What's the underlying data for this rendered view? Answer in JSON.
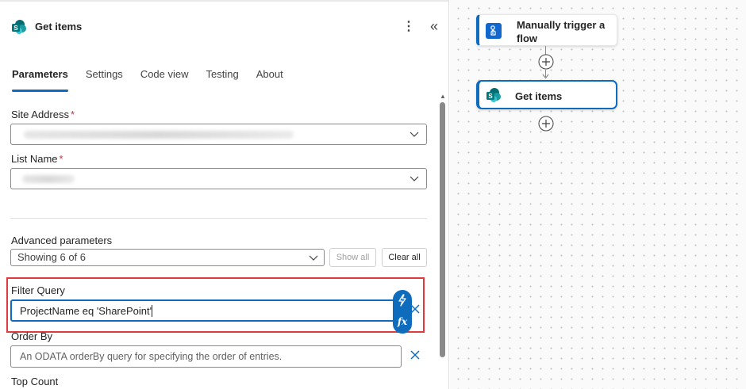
{
  "panel": {
    "title": "Get items",
    "tabs": [
      "Parameters",
      "Settings",
      "Code view",
      "Testing",
      "About"
    ],
    "active_tab": "Parameters",
    "fields": {
      "site_address": {
        "label": "Site Address",
        "required_mark": "*"
      },
      "list_name": {
        "label": "List Name",
        "required_mark": "*"
      },
      "advanced": {
        "label": "Advanced parameters",
        "value": "Showing 6 of 6",
        "show_all": "Show all",
        "clear_all": "Clear all"
      },
      "filter_query": {
        "label": "Filter Query",
        "value": "ProjectName eq 'SharePoint'"
      },
      "order_by": {
        "label": "Order By",
        "placeholder": "An ODATA orderBy query for specifying the order of entries."
      },
      "top_count": {
        "label": "Top Count"
      }
    }
  },
  "canvas": {
    "nodes": [
      {
        "title": "Manually trigger a flow",
        "line1": "Manually trigger a",
        "line2": "flow"
      },
      {
        "title": "Get items"
      }
    ]
  },
  "colors": {
    "accent": "#0f6cbd",
    "highlight": "#e0393e",
    "required": "#c4314b"
  },
  "icons": [
    "sharepoint-icon",
    "more-options-icon",
    "collapse-icon",
    "chevron-down-icon",
    "close-icon",
    "dynamic-content-icon",
    "expression-fx-icon",
    "manual-trigger-icon",
    "add-step-icon"
  ]
}
